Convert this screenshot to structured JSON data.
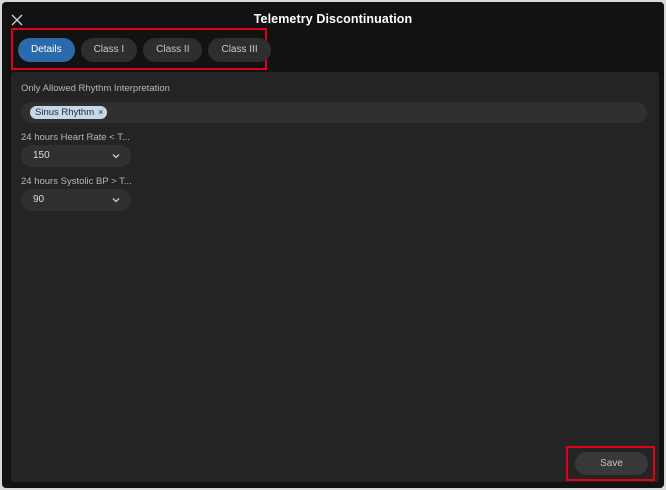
{
  "window": {
    "title": "Telemetry Discontinuation",
    "close_icon": "close-icon"
  },
  "tabs": [
    {
      "label": "Details",
      "active": true
    },
    {
      "label": "Class I",
      "active": false
    },
    {
      "label": "Class II",
      "active": false
    },
    {
      "label": "Class III",
      "active": false
    }
  ],
  "form": {
    "rhythm": {
      "label": "Only Allowed Rhythm Interpretation",
      "chips": [
        {
          "label": "Sinus Rhythm",
          "remove": "×"
        }
      ]
    },
    "heart_rate": {
      "label": "24 hours Heart Rate < T...",
      "value": "150",
      "icon": "chevron-down-icon"
    },
    "systolic_bp": {
      "label": "24 hours Systolic BP > T...",
      "value": "90",
      "icon": "chevron-down-icon"
    }
  },
  "footer": {
    "save_label": "Save"
  },
  "colors": {
    "accent": "#2a6aad",
    "highlight": "#e0001a",
    "background": "#121212",
    "panel": "#242424"
  }
}
